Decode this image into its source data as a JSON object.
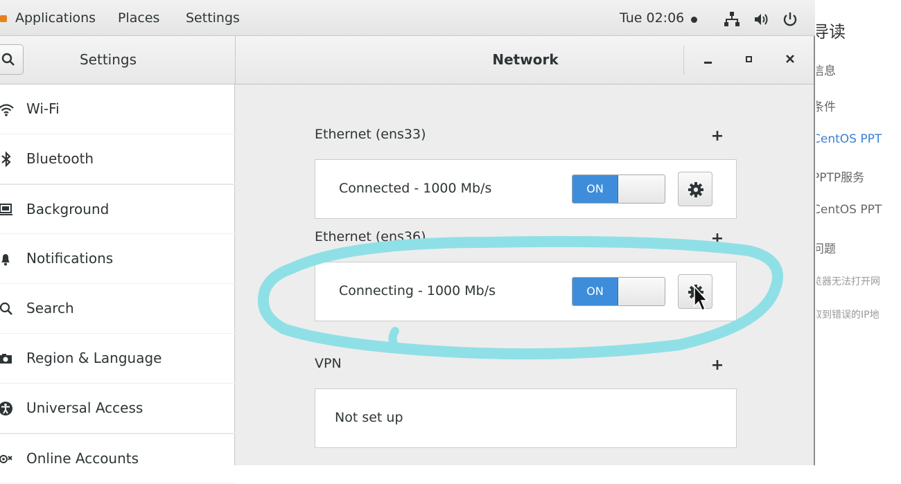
{
  "topbar": {
    "menu": [
      "Applications",
      "Places",
      "Settings"
    ],
    "clock": "Tue 02:06",
    "icons": [
      "network-wired-icon",
      "volume-icon",
      "power-icon"
    ]
  },
  "window": {
    "sidebar_title": "Settings",
    "panel_title": "Network",
    "controls": [
      "minimize",
      "maximize",
      "close"
    ]
  },
  "sidebar": {
    "items": [
      {
        "label": "Wi-Fi",
        "icon": "wifi-icon"
      },
      {
        "label": "Bluetooth",
        "icon": "bluetooth-icon"
      },
      {
        "label": "Background",
        "icon": "background-icon"
      },
      {
        "label": "Notifications",
        "icon": "bell-icon"
      },
      {
        "label": "Search",
        "icon": "search-icon"
      },
      {
        "label": "Region & Language",
        "icon": "camera-icon"
      },
      {
        "label": "Universal Access",
        "icon": "accessibility-icon"
      },
      {
        "label": "Online Accounts",
        "icon": "accounts-icon"
      }
    ]
  },
  "network": {
    "sections": [
      {
        "title": "Ethernet (ens33)",
        "add": "+",
        "status": "Connected - 1000 Mb/s",
        "switch": "ON",
        "is_on": true
      },
      {
        "title": "Ethernet (ens36)",
        "add": "+",
        "status": "Connecting - 1000 Mb/s",
        "switch": "ON",
        "is_on": true
      },
      {
        "title": "VPN",
        "add": "+",
        "status": "Not set up"
      }
    ],
    "annotation_color": "#8fe0e6",
    "accent": "#3e8ddb"
  },
  "background_page": {
    "items": [
      {
        "text": "导读",
        "color": "#333333"
      },
      {
        "text": "信息",
        "color": "#666666"
      },
      {
        "text": "条件",
        "color": "#666666"
      },
      {
        "text": "CentOS PPT",
        "color": "#3a7fd5"
      },
      {
        "text": "PPTP服务",
        "color": "#666666"
      },
      {
        "text": "CentOS PPT",
        "color": "#666666"
      },
      {
        "text": "问题",
        "color": "#666666"
      },
      {
        "text": "览器无法打开网",
        "color": "#999999"
      },
      {
        "text": "取到错误的IP地",
        "color": "#999999"
      }
    ]
  }
}
